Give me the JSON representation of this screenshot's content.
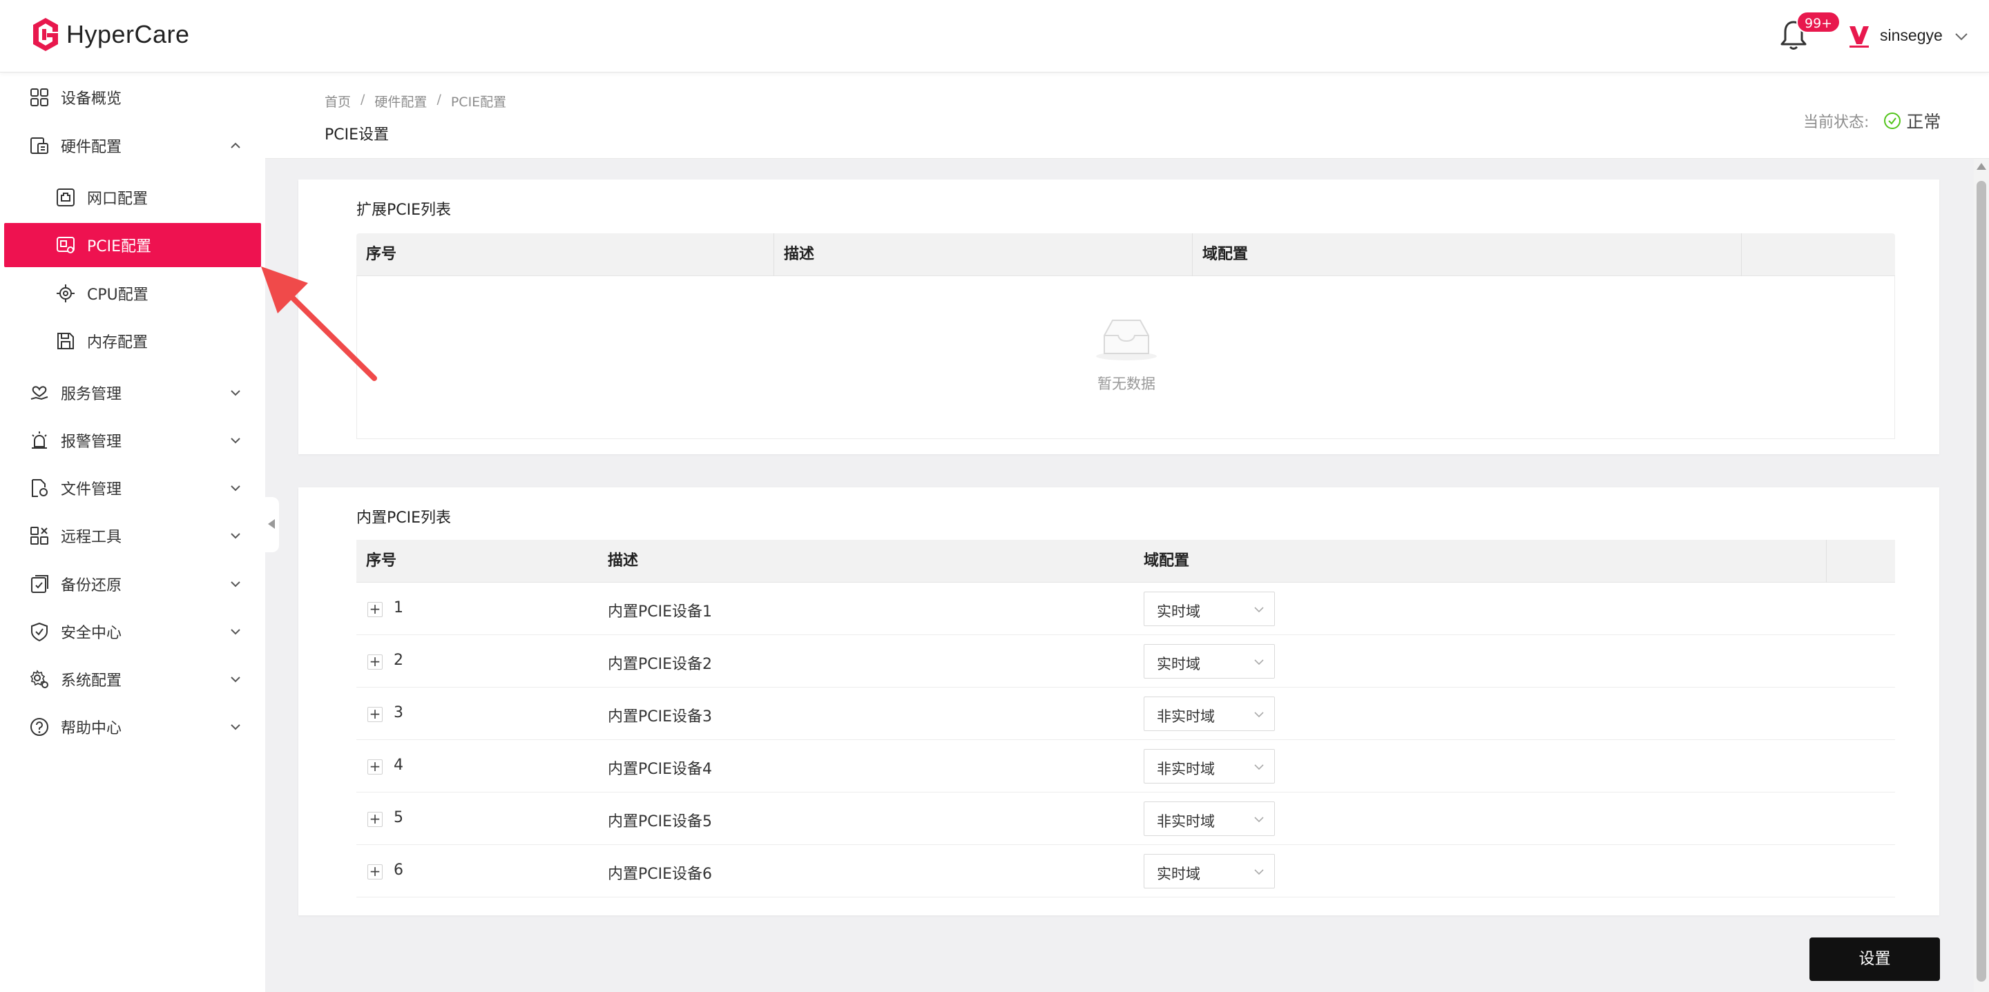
{
  "app": {
    "name": "HyperCare"
  },
  "header": {
    "notifications_badge": "99+",
    "user_name": "sinsegye"
  },
  "sidebar": {
    "items": [
      {
        "label": "设备概览",
        "icon": "grid-icon"
      },
      {
        "label": "硬件配置",
        "icon": "hardware-icon",
        "expanded": true
      },
      {
        "label": "网口配置",
        "icon": "network-port-icon"
      },
      {
        "label": "PCIE配置",
        "icon": "pcie-icon",
        "active": true
      },
      {
        "label": "CPU配置",
        "icon": "cpu-icon"
      },
      {
        "label": "内存配置",
        "icon": "memory-icon"
      },
      {
        "label": "服务管理",
        "icon": "service-icon"
      },
      {
        "label": "报警管理",
        "icon": "alarm-icon"
      },
      {
        "label": "文件管理",
        "icon": "file-icon"
      },
      {
        "label": "远程工具",
        "icon": "remote-tool-icon"
      },
      {
        "label": "备份还原",
        "icon": "backup-icon"
      },
      {
        "label": "安全中心",
        "icon": "shield-icon"
      },
      {
        "label": "系统配置",
        "icon": "settings-icon"
      },
      {
        "label": "帮助中心",
        "icon": "help-icon"
      }
    ]
  },
  "breadcrumb": [
    "首页",
    "硬件配置",
    "PCIE配置"
  ],
  "page_title": "PCIE设置",
  "status": {
    "label": "当前状态:",
    "value": "正常",
    "color": "#52c41a"
  },
  "extended_table": {
    "title": "扩展PCIE列表",
    "columns": [
      "序号",
      "描述",
      "域配置"
    ],
    "empty_text": "暂无数据"
  },
  "builtin_table": {
    "title": "内置PCIE列表",
    "columns": [
      "序号",
      "描述",
      "域配置"
    ],
    "rows": [
      {
        "index": "1",
        "description": "内置PCIE设备1",
        "domain": "实时域"
      },
      {
        "index": "2",
        "description": "内置PCIE设备2",
        "domain": "实时域"
      },
      {
        "index": "3",
        "description": "内置PCIE设备3",
        "domain": "非实时域"
      },
      {
        "index": "4",
        "description": "内置PCIE设备4",
        "domain": "非实时域"
      },
      {
        "index": "5",
        "description": "内置PCIE设备5",
        "domain": "非实时域"
      },
      {
        "index": "6",
        "description": "内置PCIE设备6",
        "domain": "实时域"
      }
    ]
  },
  "actions": {
    "set_label": "设置"
  },
  "colors": {
    "accent": "#ee1250",
    "primary_button": "#111111"
  }
}
